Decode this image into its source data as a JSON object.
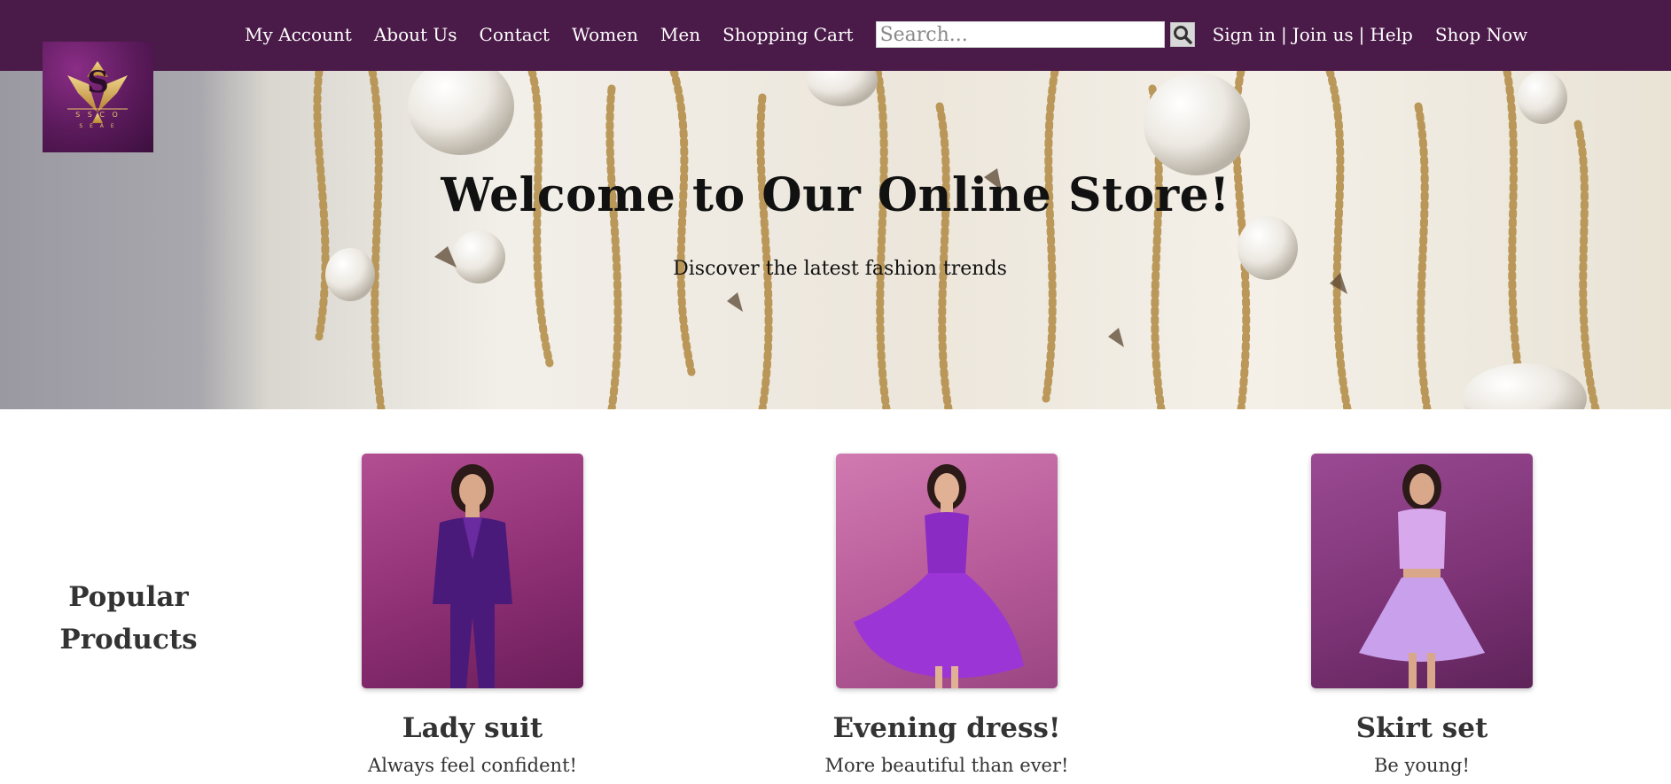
{
  "nav": {
    "links": [
      {
        "label": "My Account"
      },
      {
        "label": "About Us"
      },
      {
        "label": "Contact"
      },
      {
        "label": "Women"
      },
      {
        "label": "Men"
      },
      {
        "label": "Shopping Cart"
      }
    ],
    "search": {
      "placeholder": "Search...",
      "button_icon": "search-icon"
    },
    "account": {
      "sign_in": "Sign in",
      "join": "Join us",
      "help": "Help",
      "separator": "|"
    },
    "shop_now": "Shop Now"
  },
  "logo": {
    "letter": "S",
    "sub_text": "S S C O",
    "tag_text": "S E A E"
  },
  "hero": {
    "title": "Welcome to Our Online Store!",
    "subtitle": "Discover the latest fashion trends"
  },
  "popular": {
    "heading": "Popular Products"
  },
  "products": [
    {
      "name": "Lady suit",
      "description": "Always feel confident!"
    },
    {
      "name": "Evening dress!",
      "description": "More beautiful than ever!"
    },
    {
      "name": "Skirt set",
      "description": "Be young!"
    }
  ],
  "colors": {
    "nav_bg": "#4a1a48",
    "accent_purple": "#6a1fa3",
    "gold": "#c9a34a"
  }
}
